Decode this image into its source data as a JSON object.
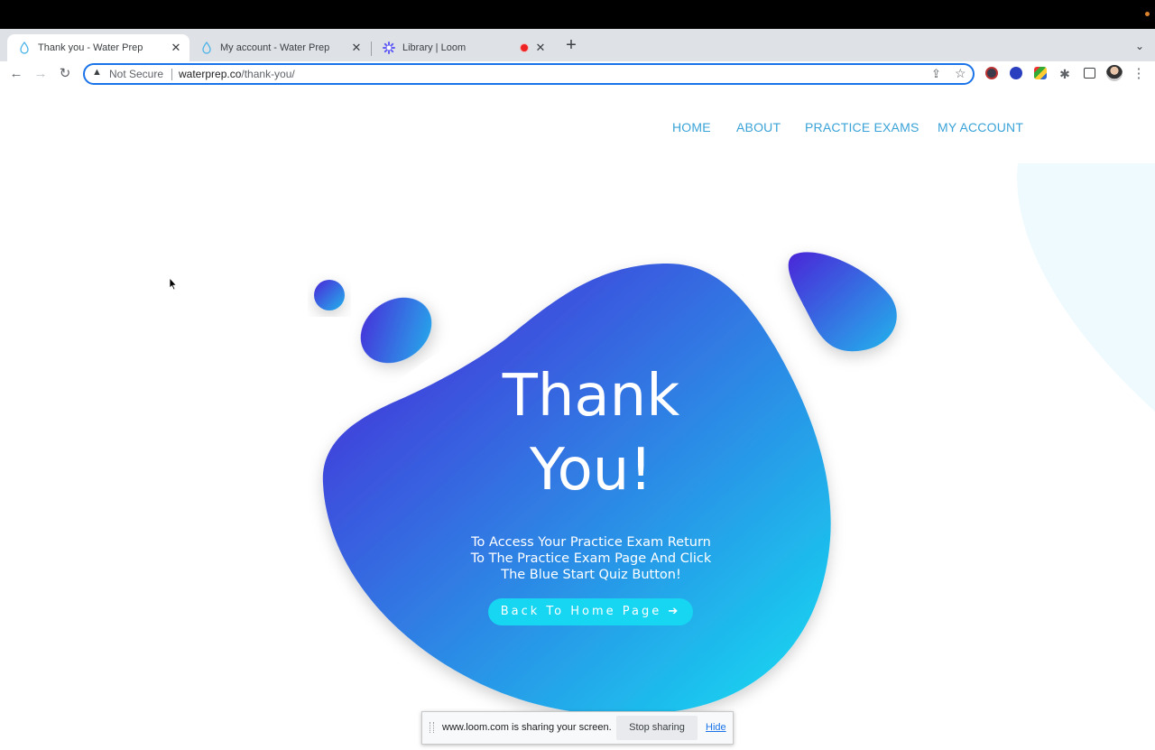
{
  "browser": {
    "tabs": [
      {
        "title": "Thank you - Water Prep",
        "active": true
      },
      {
        "title": "My account - Water Prep",
        "active": false
      },
      {
        "title": "Library | Loom",
        "active": false
      }
    ],
    "close_glyph": "✕",
    "new_tab_glyph": "+",
    "tab_menu_glyph": "⌄",
    "security_label": "Not Secure",
    "url_domain": "waterprep.co",
    "url_path": "/thank-you/"
  },
  "site": {
    "nav": [
      {
        "label": "HOME"
      },
      {
        "label": "ABOUT"
      },
      {
        "label": "PRACTICE EXAMS"
      },
      {
        "label": "MY ACCOUNT"
      }
    ],
    "heading_line1": "Thank",
    "heading_line2": "You!",
    "message_line1": "To Access Your Practice Exam Return",
    "message_line2": "To The Practice Exam Page And Click",
    "message_line3": "The Blue Start Quiz Button!",
    "cta_label": "Back To Home Page",
    "colors": {
      "nav_link": "#3aa3d8",
      "blob_start": "#4a1fd6",
      "blob_end": "#14e0f2",
      "cta": "#16d6f2"
    }
  },
  "share_bar": {
    "message": "www.loom.com is sharing your screen.",
    "stop_label": "Stop sharing",
    "hide_label": "Hide"
  }
}
